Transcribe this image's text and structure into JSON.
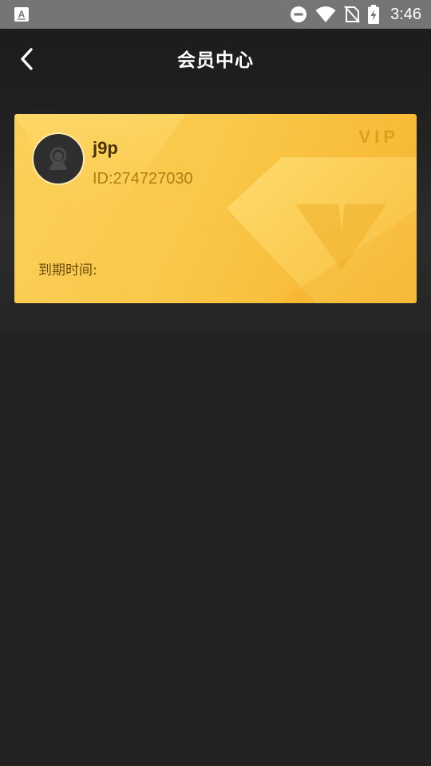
{
  "status_bar": {
    "time": "3:46",
    "icons": [
      "text-a-icon",
      "do-not-disturb-icon",
      "wifi-icon",
      "no-sim-icon",
      "battery-charging-icon"
    ]
  },
  "header": {
    "title": "会员中心",
    "back_icon": "chevron-left-icon"
  },
  "member_card": {
    "username": "j9p",
    "user_id": "ID:274727030",
    "badge": "VIP",
    "expire_label": "到期时间:",
    "avatar_icon": "user-avatar-icon"
  },
  "colors": {
    "background": "#222222",
    "status_bar": "#757575",
    "card_gold": "#f9c548",
    "username": "#4a3200",
    "user_id": "#b07d10",
    "vip_badge": "#d8a21e"
  }
}
